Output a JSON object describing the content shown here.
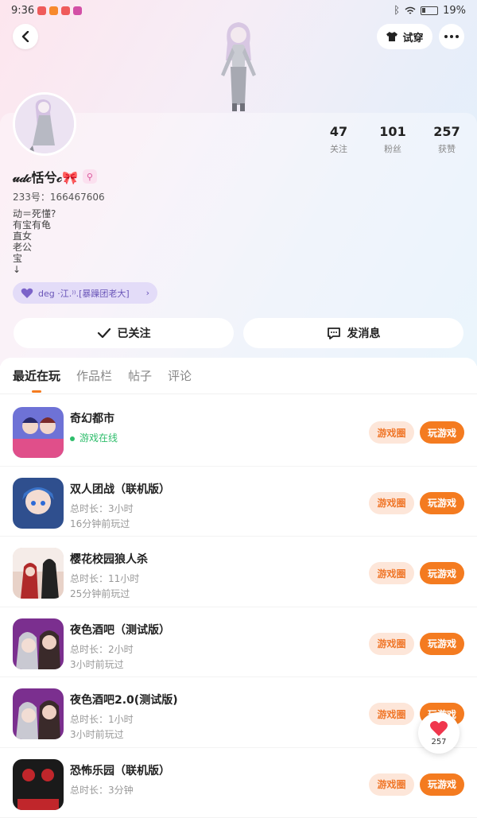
{
  "status_bar": {
    "time": "9:36",
    "battery": "19%"
  },
  "header": {
    "try_on_label": "试穿"
  },
  "profile": {
    "username": "𝓊𝒹𝒸恬兮𝒸🎀",
    "uid": "233号：166467606",
    "bio": [
      "动＝死懂?",
      "有宝有龟",
      "直女",
      "老公",
      "宝",
      "↓"
    ],
    "group_tag": "deg ·江.⁾⁾.[暴躁团老大]",
    "stats": [
      {
        "value": "47",
        "label": "关注"
      },
      {
        "value": "101",
        "label": "粉丝"
      },
      {
        "value": "257",
        "label": "获赞"
      }
    ]
  },
  "actions": {
    "followed_label": "已关注",
    "message_label": "发消息"
  },
  "tabs": [
    "最近在玩",
    "作品栏",
    "帖子",
    "评论"
  ],
  "games": [
    {
      "title": "奇幻都市",
      "sub1": "游戏在线",
      "sub2": ""
    },
    {
      "title": "双人团战（联机版）",
      "sub1": "总时长：3小时",
      "sub2": "16分钟前玩过"
    },
    {
      "title": "樱花校园狼人杀",
      "sub1": "总时长：11小时",
      "sub2": "25分钟前玩过"
    },
    {
      "title": "夜色酒吧（测试版）",
      "sub1": "总时长：2小时",
      "sub2": "3小时前玩过"
    },
    {
      "title": "夜色酒吧2.0(测试版)",
      "sub1": "总时长：1小时",
      "sub2": "3小时前玩过"
    },
    {
      "title": "恐怖乐园（联机版）",
      "sub1": "总时长：3分钟",
      "sub2": ""
    }
  ],
  "game_buttons": {
    "circle": "游戏圈",
    "play": "玩游戏"
  },
  "like_float": {
    "count": "257"
  },
  "colors": {
    "accent": "#f47b20",
    "online": "#2ebd6b"
  }
}
